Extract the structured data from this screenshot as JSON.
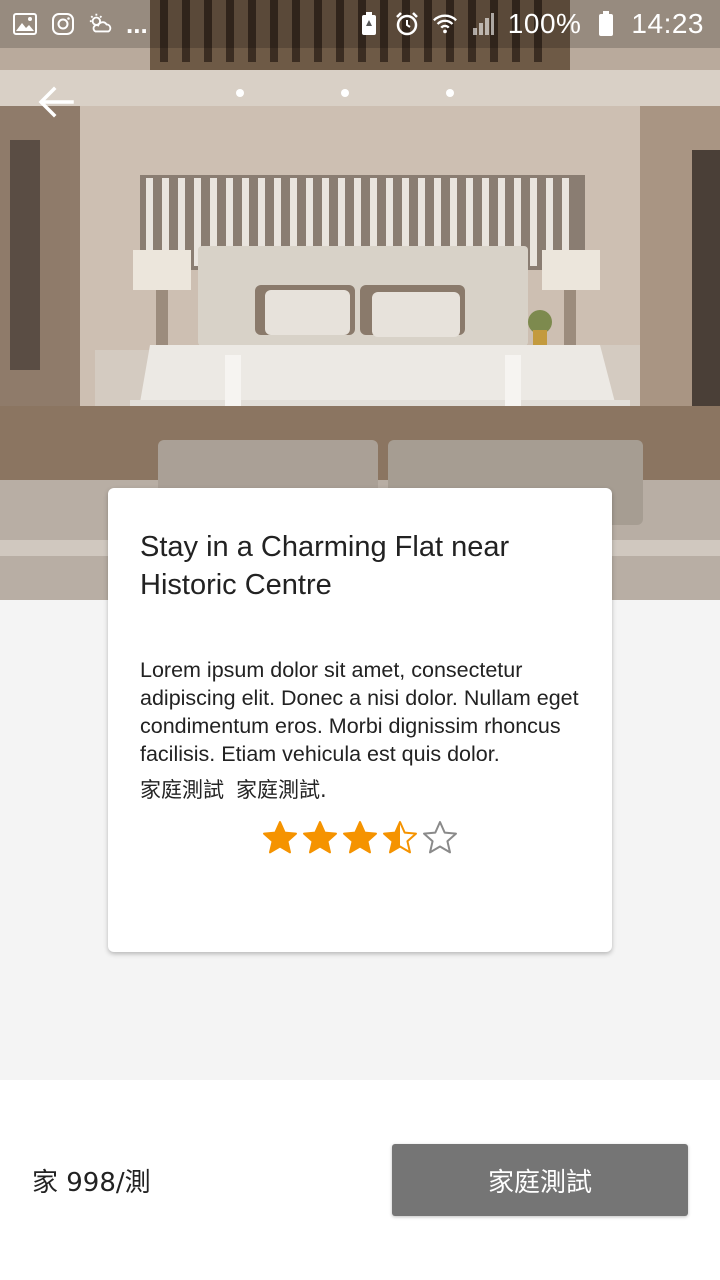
{
  "status_bar": {
    "battery_percent": "100%",
    "time": "14:23",
    "overflow": "...",
    "left_icons": [
      "gallery-icon",
      "instagram-icon",
      "weather-icon"
    ],
    "right_icons": [
      "battery-saver-icon",
      "alarm-icon",
      "wifi-icon",
      "signal-icon",
      "battery-icon"
    ]
  },
  "header": {
    "back_icon": "arrow-left-icon"
  },
  "listing": {
    "title": "Stay in a Charming Flat near Historic Centre",
    "description": "Lorem ipsum dolor sit amet, consectetur adipiscing elit. Donec a nisi dolor. Nullam eget condimentum eros. Morbi dignissim rhoncus facilisis. Etiam vehicula est quis dolor.",
    "tags": [
      "家庭測試",
      "家庭測試."
    ],
    "rating": 3.5,
    "rating_max": 5,
    "star_color": "#F59300"
  },
  "footer": {
    "price": "家 998/測",
    "book_label": "家庭測試",
    "button_color": "#757575"
  }
}
